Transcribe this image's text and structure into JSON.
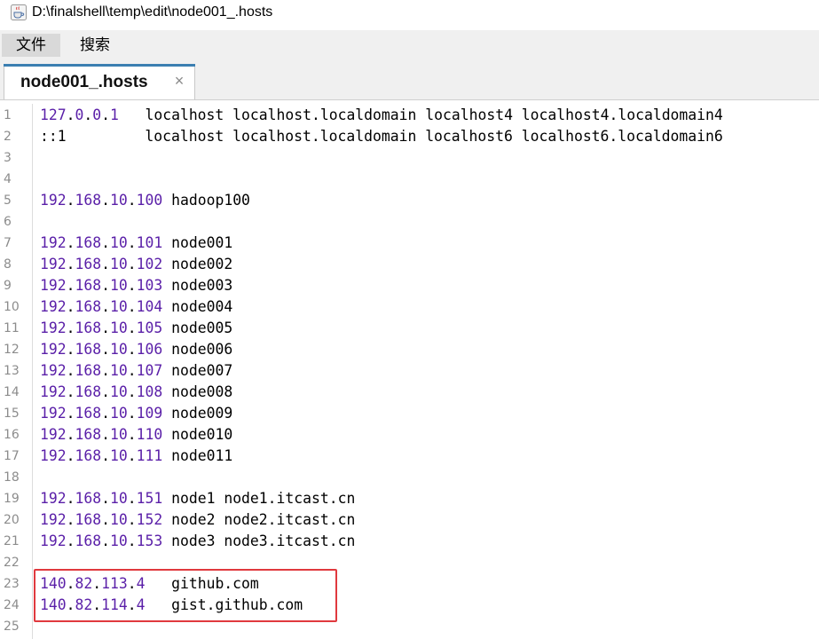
{
  "window": {
    "title": "D:\\finalshell\\temp\\edit\\node001_.hosts",
    "icon": "java-coffee-icon"
  },
  "menu": {
    "file_label": "文件",
    "search_label": "搜索"
  },
  "tab": {
    "label": "node001_.hosts",
    "close_glyph": "×"
  },
  "editor": {
    "lines": [
      {
        "n": "1",
        "ip": "127.0.0.1",
        "rest": "   localhost localhost.localdomain localhost4 localhost4.localdomain4"
      },
      {
        "n": "2",
        "ip": "",
        "rest": "::1         localhost localhost.localdomain localhost6 localhost6.localdomain6"
      },
      {
        "n": "3",
        "ip": "",
        "rest": ""
      },
      {
        "n": "4",
        "ip": "",
        "rest": ""
      },
      {
        "n": "5",
        "ip": "192.168.10.100",
        "rest": " hadoop100"
      },
      {
        "n": "6",
        "ip": "",
        "rest": ""
      },
      {
        "n": "7",
        "ip": "192.168.10.101",
        "rest": " node001"
      },
      {
        "n": "8",
        "ip": "192.168.10.102",
        "rest": " node002"
      },
      {
        "n": "9",
        "ip": "192.168.10.103",
        "rest": " node003"
      },
      {
        "n": "10",
        "ip": "192.168.10.104",
        "rest": " node004"
      },
      {
        "n": "11",
        "ip": "192.168.10.105",
        "rest": " node005"
      },
      {
        "n": "12",
        "ip": "192.168.10.106",
        "rest": " node006"
      },
      {
        "n": "13",
        "ip": "192.168.10.107",
        "rest": " node007"
      },
      {
        "n": "14",
        "ip": "192.168.10.108",
        "rest": " node008"
      },
      {
        "n": "15",
        "ip": "192.168.10.109",
        "rest": " node009"
      },
      {
        "n": "16",
        "ip": "192.168.10.110",
        "rest": " node010"
      },
      {
        "n": "17",
        "ip": "192.168.10.111",
        "rest": " node011"
      },
      {
        "n": "18",
        "ip": "",
        "rest": ""
      },
      {
        "n": "19",
        "ip": "192.168.10.151",
        "rest": " node1 node1.itcast.cn"
      },
      {
        "n": "20",
        "ip": "192.168.10.152",
        "rest": " node2 node2.itcast.cn"
      },
      {
        "n": "21",
        "ip": "192.168.10.153",
        "rest": " node3 node3.itcast.cn"
      },
      {
        "n": "22",
        "ip": "",
        "rest": ""
      },
      {
        "n": "23",
        "ip": "140.82.113.4",
        "rest": "   github.com"
      },
      {
        "n": "24",
        "ip": "140.82.114.4",
        "rest": "   gist.github.com"
      },
      {
        "n": "25",
        "ip": "",
        "rest": ""
      }
    ]
  },
  "colors": {
    "ip_digits": "#5a1fa8",
    "highlight_border": "#e0393e",
    "tab_accent": "#3c7fb1"
  }
}
